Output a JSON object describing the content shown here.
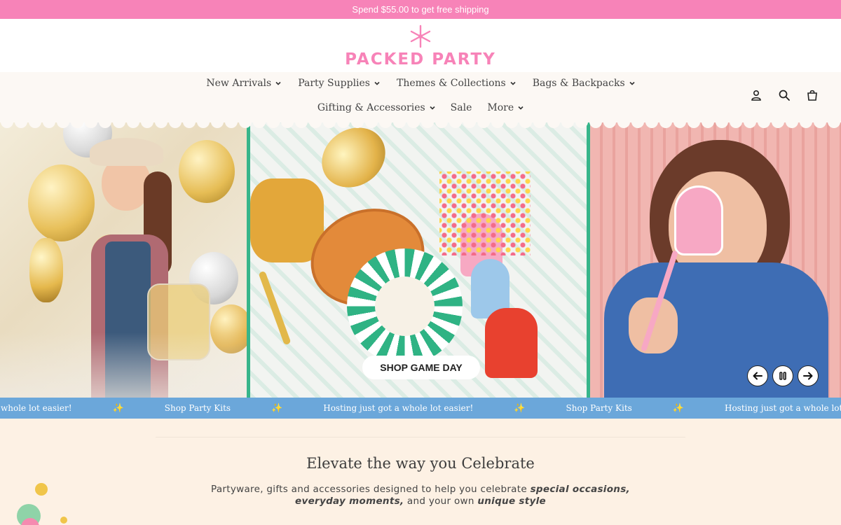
{
  "announcement": "Spend $55.00 to get free shipping",
  "brand": {
    "name": "PACKED PARTY",
    "accent": "#f783b8"
  },
  "nav": {
    "row1": [
      {
        "label": "New Arrivals",
        "has_dropdown": true
      },
      {
        "label": "Party Supplies",
        "has_dropdown": true
      },
      {
        "label": "Themes & Collections",
        "has_dropdown": true
      },
      {
        "label": "Bags & Backpacks",
        "has_dropdown": true
      }
    ],
    "row2": [
      {
        "label": "Gifting & Accessories",
        "has_dropdown": true
      },
      {
        "label": "Sale",
        "has_dropdown": false
      },
      {
        "label": "More",
        "has_dropdown": true
      }
    ],
    "icons": [
      "account-icon",
      "search-icon",
      "cart-icon"
    ]
  },
  "hero": {
    "cta": "SHOP GAME DAY",
    "controls": [
      "previous-slide-icon",
      "pause-icon",
      "next-slide-icon"
    ]
  },
  "marquee": {
    "items": [
      "a whole lot easier!",
      "Shop Party Kits",
      "Hosting just got a whole lot easier!",
      "Shop Party Kits",
      "Hosting just got a whole lot easier!"
    ],
    "separator_icon": "sparkle-icon",
    "color": "#6ba7da"
  },
  "intro": {
    "heading": "Elevate the way you Celebrate",
    "text_1": "Partyware, gifts and accessories designed to help you celebrate ",
    "emph_1": "special occasions, everyday moments,",
    "text_2": " and your own ",
    "emph_2": "unique style"
  }
}
